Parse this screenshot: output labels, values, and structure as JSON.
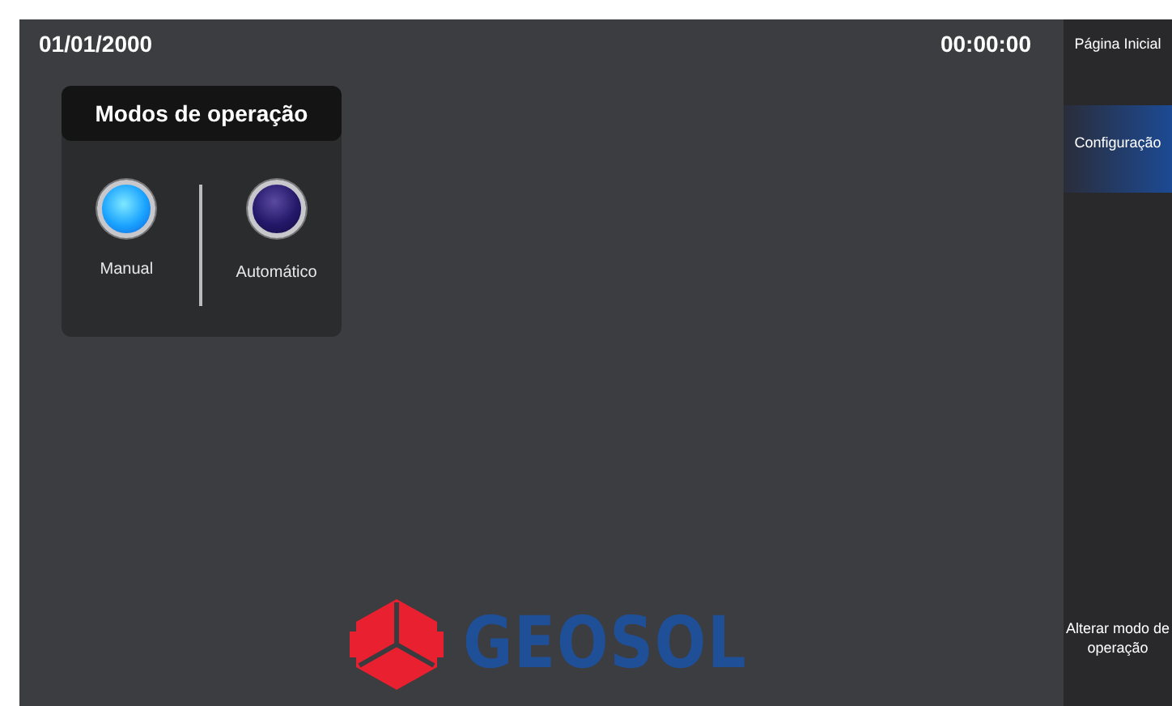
{
  "header": {
    "date": "01/01/2000",
    "time": "00:00:00"
  },
  "modes_panel": {
    "title": "Modos de operação",
    "modes": [
      {
        "label": "Manual",
        "selected": true
      },
      {
        "label": "Automático",
        "selected": false
      }
    ]
  },
  "logo": {
    "text": "GEOSOL"
  },
  "sidebar": {
    "items": [
      {
        "label": "Página Inicial",
        "selected": false
      },
      {
        "label": "Configuração",
        "selected": true
      },
      {
        "label": "Alterar modo de operação",
        "selected": false
      }
    ]
  }
}
